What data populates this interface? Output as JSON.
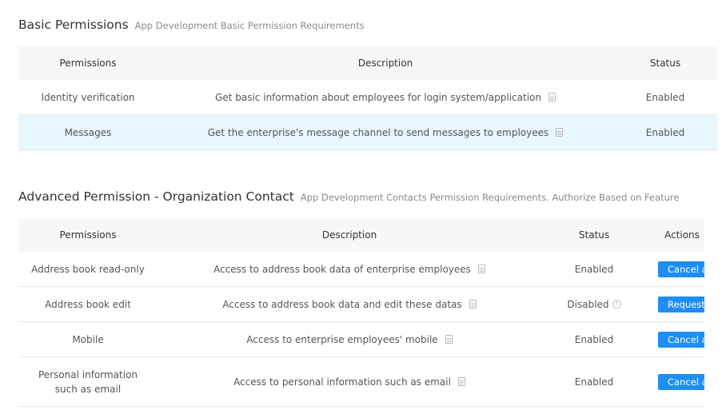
{
  "basic": {
    "title": "Basic Permissions",
    "subtitle": "App Development Basic Permission Requirements",
    "headers": {
      "permissions": "Permissions",
      "description": "Description",
      "status": "Status"
    },
    "rows": [
      {
        "permission": "Identity verification",
        "description": "Get basic information about employees for login system/application",
        "status": "Enabled"
      },
      {
        "permission": "Messages",
        "description": "Get the enterprise's message channel to send messages to employees",
        "status": "Enabled"
      }
    ]
  },
  "advanced": {
    "title": "Advanced Permission - Organization Contact",
    "subtitle": "App Development Contacts Permission Requirements. Authorize Based on Feature",
    "headers": {
      "permissions": "Permissions",
      "description": "Description",
      "status": "Status",
      "actions": "Actions"
    },
    "rows": [
      {
        "permission": "Address book read-only",
        "description": "Access to address book data of enterprise employees",
        "status": "Enabled",
        "action": "Cancel authorization"
      },
      {
        "permission": "Address book edit",
        "description": "Access to address book data and edit these datas",
        "status": "Disabled",
        "action": "Request"
      },
      {
        "permission": "Mobile",
        "description": "Access to enterprise employees' mobile",
        "status": "Enabled",
        "action": "Cancel authorization"
      },
      {
        "permission": "Personal information such as email",
        "description": "Access to personal information such as email",
        "status": "Enabled",
        "action": "Cancel authorization"
      }
    ]
  },
  "icons": {
    "doc": "document-icon",
    "help": "help-circle-icon"
  },
  "colors": {
    "accent": "#1e8ef5",
    "highlight_row": "#e8f6fd",
    "header_bg": "#f7f7f7"
  }
}
